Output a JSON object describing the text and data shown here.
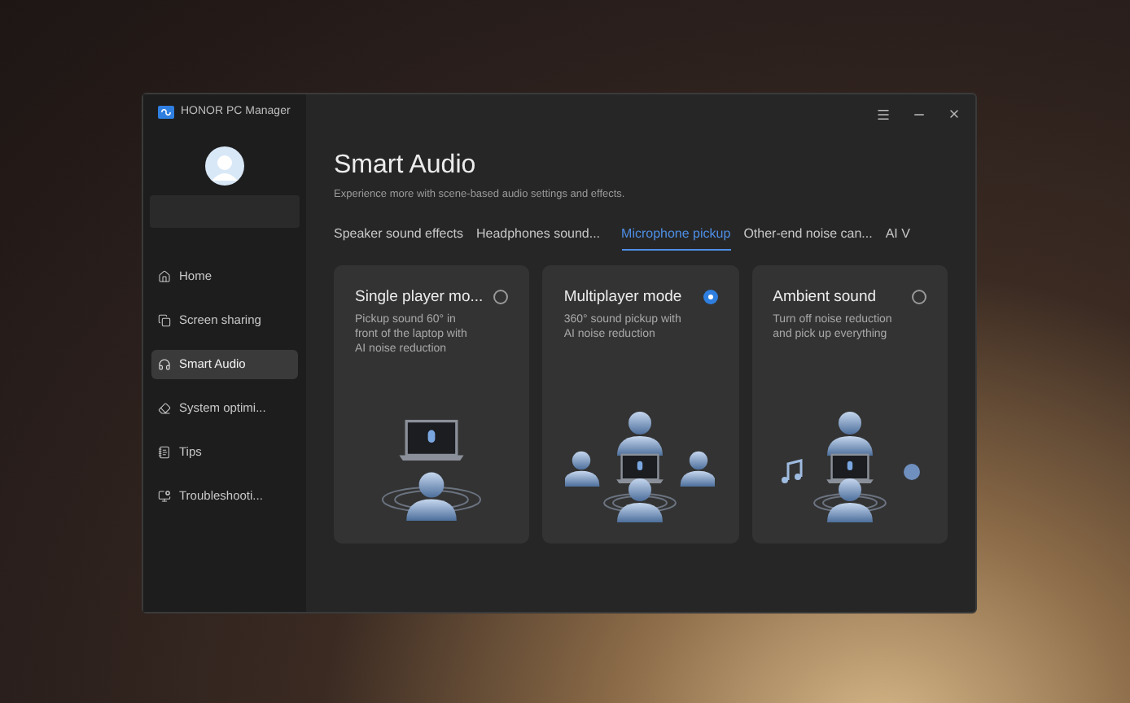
{
  "app": {
    "title": "HONOR PC Manager"
  },
  "sidebar": {
    "items": [
      {
        "label": "Home",
        "kind": "home",
        "selected": false
      },
      {
        "label": "Screen sharing",
        "kind": "share",
        "selected": false
      },
      {
        "label": "Smart Audio",
        "kind": "audio",
        "selected": true
      },
      {
        "label": "System optimi...",
        "kind": "optimize",
        "selected": false
      },
      {
        "label": "Tips",
        "kind": "tips",
        "selected": false
      },
      {
        "label": "Troubleshooti...",
        "kind": "trouble",
        "selected": false
      }
    ]
  },
  "page": {
    "title": "Smart Audio",
    "subtitle": "Experience more with scene-based audio settings and effects."
  },
  "tabs": [
    {
      "label": "Speaker sound effects",
      "selected": false
    },
    {
      "label": "Headphones sound...",
      "selected": false
    },
    {
      "label": "Microphone pickup",
      "selected": true
    },
    {
      "label": "Other-end noise can...",
      "selected": false
    },
    {
      "label": "AI V",
      "selected": false
    }
  ],
  "modes": [
    {
      "kind": "single",
      "title": "Single player mo...",
      "description": "Pickup sound 60° in front of the laptop with AI noise reduction",
      "selected": false
    },
    {
      "kind": "multi",
      "title": "Multiplayer mode",
      "description": "360° sound pickup with AI noise reduction",
      "selected": true
    },
    {
      "kind": "ambient",
      "title": "Ambient sound",
      "description": "Turn off noise reduction and pick up everything",
      "selected": false
    }
  ]
}
